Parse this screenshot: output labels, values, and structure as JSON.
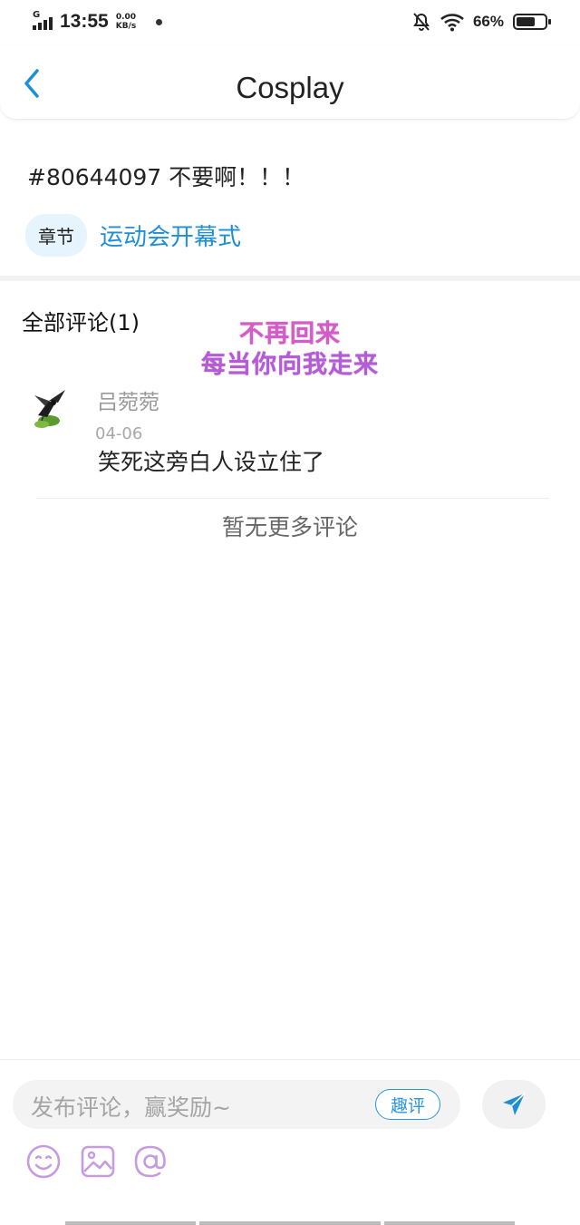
{
  "status_bar": {
    "network": "G",
    "time": "13:55",
    "speed_value": "0.00",
    "speed_unit": "KB/s",
    "battery": "66%",
    "battery_level": 0.66
  },
  "header": {
    "title": "Cosplay"
  },
  "post": {
    "title": "#80644097 不要啊！！！",
    "chapter_tag": "章节",
    "chapter_name": "运动会开幕式"
  },
  "comments": {
    "heading": "全部评论(1)",
    "items": [
      {
        "user": "吕菀菀",
        "date": "04-06",
        "text": "笑死这旁白人设立住了"
      }
    ],
    "no_more": "暂无更多评论"
  },
  "overlay": {
    "line1": "不再回来",
    "line2": "每当你向我走来"
  },
  "composer": {
    "placeholder": "发布评论，赢奖励~",
    "fun_button": "趣评"
  },
  "icons": {
    "back": "chevron-left-icon",
    "send": "send-icon",
    "emoji": "emoji-icon",
    "image": "image-icon",
    "mention": "at-icon"
  },
  "colors": {
    "accent": "#1e8fd6",
    "tag_bg": "#e6f4fd",
    "tool_icon": "#c79be0",
    "overlay": "#d65ac8"
  }
}
